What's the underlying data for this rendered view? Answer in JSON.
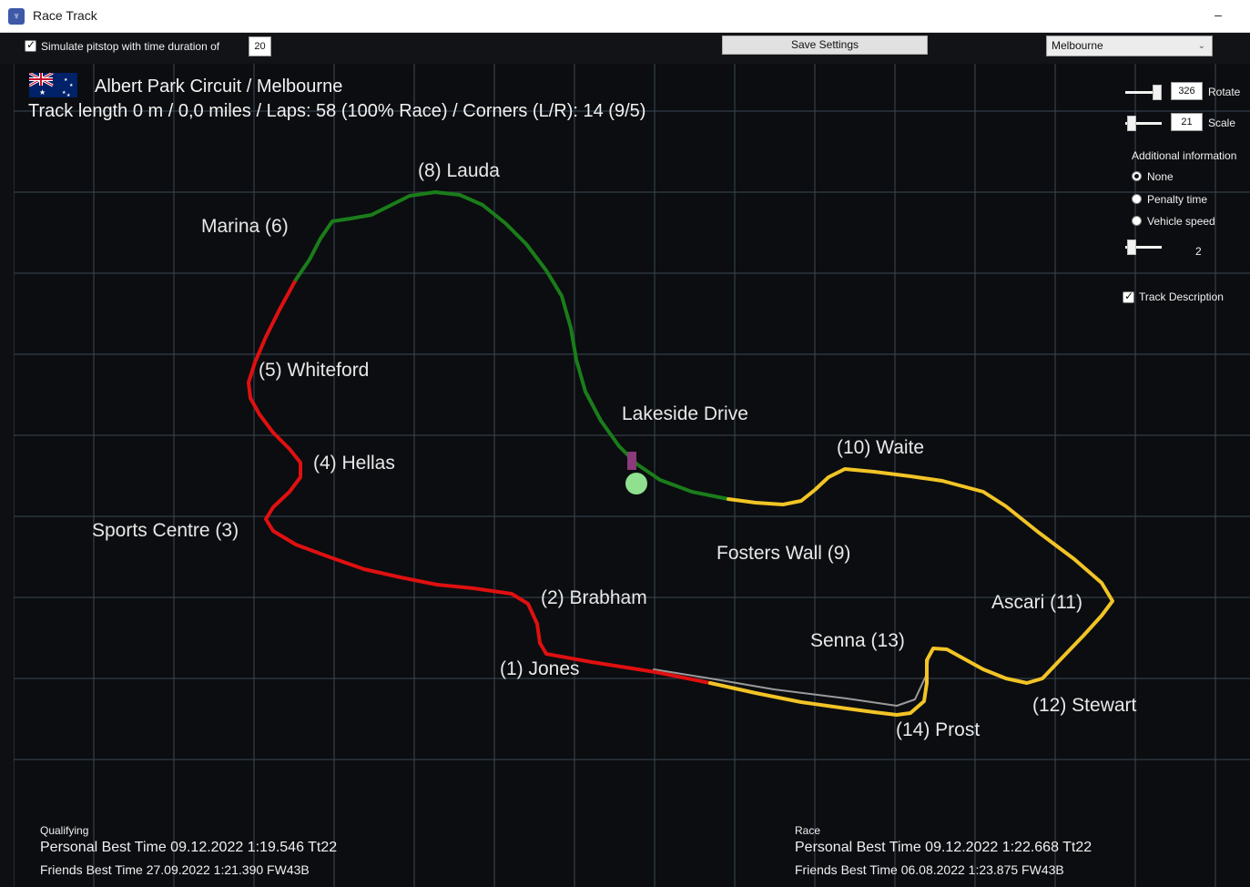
{
  "window": {
    "title": "Race Track",
    "minimize_glyph": "–"
  },
  "toolbar": {
    "pitstop_checked": true,
    "pitstop_label": "Simulate pitstop with time duration of",
    "pitstop_duration": "20",
    "save_label": "Save Settings",
    "track_select": "Melbourne"
  },
  "track": {
    "name": "Albert Park Circuit / Melbourne",
    "summary": "Track length 0 m / 0,0 miles / Laps: 58 (100% Race) / Corners (L/R): 14 (9/5)",
    "flag": "australia-flag"
  },
  "corners": [
    {
      "label": "(8) Lauda"
    },
    {
      "label": "Marina (6)"
    },
    {
      "label": "(5) Whiteford"
    },
    {
      "label": "Lakeside Drive"
    },
    {
      "label": "(4) Hellas"
    },
    {
      "label": "(10) Waite"
    },
    {
      "label": "Sports Centre (3)"
    },
    {
      "label": "Fosters Wall (9)"
    },
    {
      "label": "(2) Brabham"
    },
    {
      "label": "Ascari (11)"
    },
    {
      "label": "Senna (13)"
    },
    {
      "label": "(1) Jones"
    },
    {
      "label": "(12) Stewart"
    },
    {
      "label": "(14) Prost"
    }
  ],
  "controls": {
    "rotate_value": "326",
    "rotate_label": "Rotate",
    "scale_value": "21",
    "scale_label": "Scale",
    "additional_heading": "Additional information",
    "options": [
      "None",
      "Penalty time",
      "Vehicle speed"
    ],
    "selected_option": "None",
    "info_slider_value": "2",
    "track_description_checked": true,
    "track_description_label": "Track Description"
  },
  "colors": {
    "sector1": "#e01010",
    "sector2": "#1a7d1a",
    "sector3": "#f2c425",
    "pit_lane": "#9a9a9a",
    "start_marker": "#8b3a7a",
    "car_dot": "#8fe08f",
    "grid": "#3a4650"
  },
  "qualifying": {
    "heading": "Qualifying",
    "personal_best": "Personal Best Time 09.12.2022 1:19.546 Tt22",
    "friends_best": "Friends Best Time 27.09.2022 1:21.390 FW43B"
  },
  "race": {
    "heading": "Race",
    "personal_best": "Personal Best Time 09.12.2022 1:22.668 Tt22",
    "friends_best": "Friends Best Time 06.08.2022 1:23.875 FW43B"
  }
}
